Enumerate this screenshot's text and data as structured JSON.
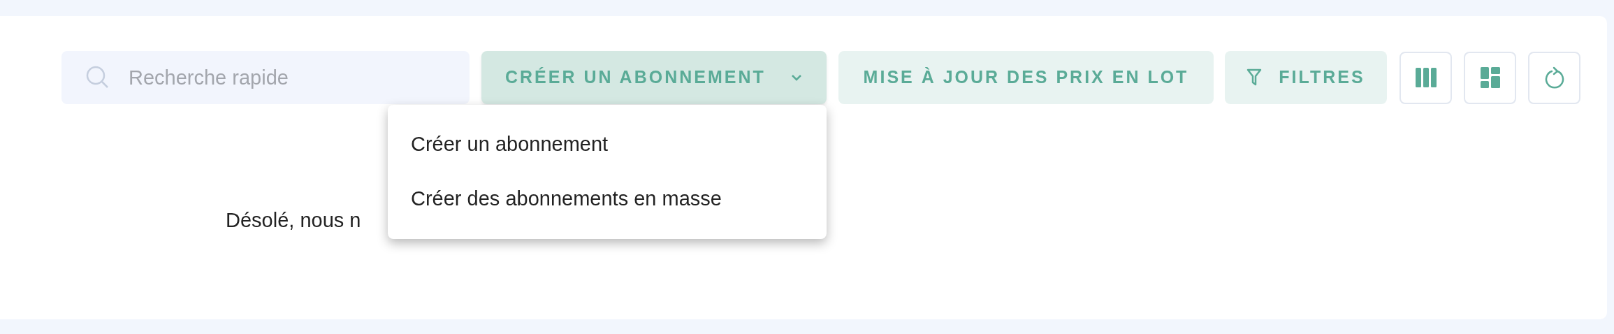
{
  "search": {
    "placeholder": "Recherche rapide"
  },
  "create_button": {
    "label": "CRÉER UN ABONNEMENT",
    "expanded": true
  },
  "create_menu": {
    "items": [
      "Créer un abonnement",
      "Créer des abonnements en masse"
    ]
  },
  "bulk_price_button": {
    "label": "MISE À JOUR DES PRIX EN LOT"
  },
  "filters_button": {
    "label": "FILTRES"
  },
  "empty_message": "Désolé, nous n"
}
